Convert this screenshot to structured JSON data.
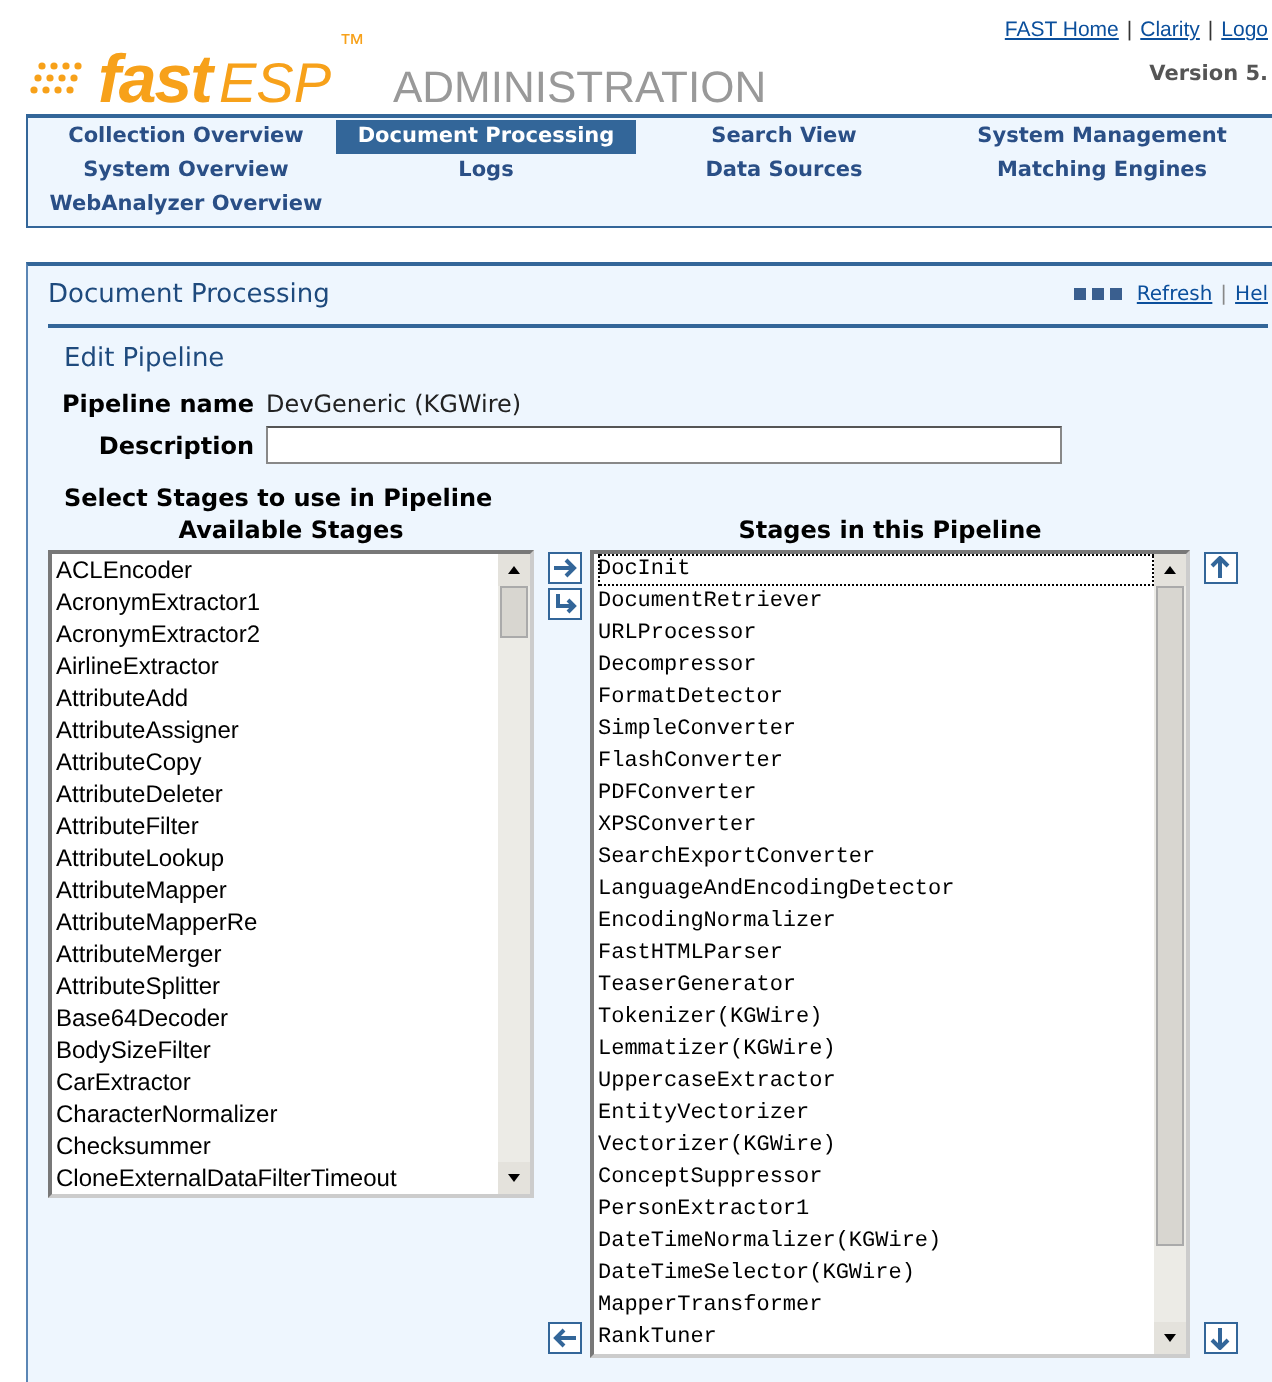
{
  "header": {
    "logo": {
      "brand": "fast",
      "product": "ESP",
      "mark": "™",
      "subtitle": "ADMINISTRATION"
    },
    "links": [
      "FAST Home",
      "Clarity",
      "Logo"
    ],
    "separator": "|",
    "version": "Version 5."
  },
  "nav": [
    {
      "label": "Collection Overview",
      "selected": false
    },
    {
      "label": "Document Processing",
      "selected": true
    },
    {
      "label": "Search View",
      "selected": false
    },
    {
      "label": "System Management",
      "selected": false
    },
    {
      "label": "System Overview",
      "selected": false
    },
    {
      "label": "Logs",
      "selected": false
    },
    {
      "label": "Data Sources",
      "selected": false
    },
    {
      "label": "Matching Engines",
      "selected": false
    },
    {
      "label": "WebAnalyzer Overview",
      "selected": false
    }
  ],
  "panel": {
    "title": "Document Processing",
    "links": [
      "Refresh",
      "Hel"
    ],
    "separator": "|",
    "section": "Edit Pipeline",
    "pipeline_name": {
      "label": "Pipeline name",
      "value": "DevGeneric (KGWire)"
    },
    "description": {
      "label": "Description"
    },
    "stages_heading": "Select Stages to use in Pipeline",
    "available": {
      "title": "Available Stages",
      "items": [
        "ACLEncoder",
        "AcronymExtractor1",
        "AcronymExtractor2",
        "AirlineExtractor",
        "AttributeAdd",
        "AttributeAssigner",
        "AttributeCopy",
        "AttributeDeleter",
        "AttributeFilter",
        "AttributeLookup",
        "AttributeMapper",
        "AttributeMapperRe",
        "AttributeMerger",
        "AttributeSplitter",
        "Base64Decoder",
        "BodySizeFilter",
        "CarExtractor",
        "CharacterNormalizer",
        "Checksummer",
        "CloneExternalDataFilterTimeout"
      ]
    },
    "pipeline": {
      "title": "Stages in this Pipeline",
      "items": [
        "DocInit",
        "DocumentRetriever",
        "URLProcessor",
        "Decompressor",
        "FormatDetector",
        "SimpleConverter",
        "FlashConverter",
        "PDFConverter",
        "XPSConverter",
        "SearchExportConverter",
        "LanguageAndEncodingDetector",
        "EncodingNormalizer",
        "FastHTMLParser",
        "TeaserGenerator",
        "Tokenizer(KGWire)",
        "Lemmatizer(KGWire)",
        "UppercaseExtractor",
        "EntityVectorizer",
        "Vectorizer(KGWire)",
        "ConceptSuppressor",
        "PersonExtractor1",
        "DateTimeNormalizer(KGWire)",
        "DateTimeSelector(KGWire)",
        "MapperTransformer",
        "RankTuner"
      ]
    }
  }
}
